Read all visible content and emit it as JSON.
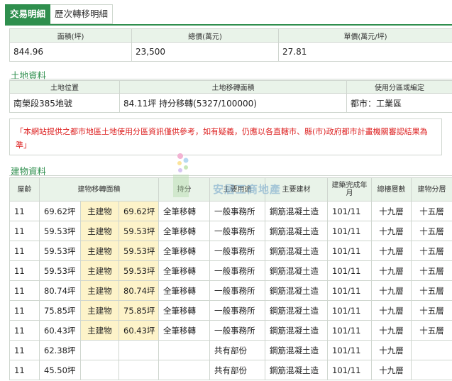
{
  "tabs": [
    {
      "label": "交易明細",
      "active": true
    },
    {
      "label": "歷次轉移明細",
      "active": false
    }
  ],
  "price": {
    "headers": [
      "面積(坪)",
      "總價(萬元)",
      "單價(萬元/坪)"
    ],
    "values": [
      "844.96",
      "23,500",
      "27.81"
    ]
  },
  "land": {
    "title": "土地資料",
    "headers": [
      "土地位置",
      "土地移轉面積",
      "使用分區或編定"
    ],
    "values": [
      "南榮段385地號",
      "84.11坪 持分移轉(5327/100000)",
      "都市：工業區"
    ]
  },
  "notice": "「本網站提供之都市地區土地使用分區資訊僅供參考，如有疑義，仍應以各直轄市、縣(市)政府都市計畫機關審認結果為準」",
  "building": {
    "title": "建物資料",
    "headers": {
      "age": "屋齡",
      "area": "建物移轉面積",
      "share": "持分",
      "use": "主要用途",
      "material": "主要建材",
      "built": "建築完成年月",
      "total_floors": "總樓層數",
      "floor": "建物分層"
    },
    "rows": [
      {
        "age": "11",
        "area": "69.62坪",
        "sub_label": "主建物",
        "sub_area": "69.62坪",
        "share": "全筆移轉",
        "use": "一般事務所",
        "material": "鋼筋混凝土造",
        "built": "101/11",
        "total_floors": "十九層",
        "floor": "十五層"
      },
      {
        "age": "11",
        "area": "59.53坪",
        "sub_label": "主建物",
        "sub_area": "59.53坪",
        "share": "全筆移轉",
        "use": "一般事務所",
        "material": "鋼筋混凝土造",
        "built": "101/11",
        "total_floors": "十九層",
        "floor": "十五層"
      },
      {
        "age": "11",
        "area": "59.53坪",
        "sub_label": "主建物",
        "sub_area": "59.53坪",
        "share": "全筆移轉",
        "use": "一般事務所",
        "material": "鋼筋混凝土造",
        "built": "101/11",
        "total_floors": "十九層",
        "floor": "十五層"
      },
      {
        "age": "11",
        "area": "59.53坪",
        "sub_label": "主建物",
        "sub_area": "59.53坪",
        "share": "全筆移轉",
        "use": "一般事務所",
        "material": "鋼筋混凝土造",
        "built": "101/11",
        "total_floors": "十九層",
        "floor": "十五層"
      },
      {
        "age": "11",
        "area": "80.74坪",
        "sub_label": "主建物",
        "sub_area": "80.74坪",
        "share": "全筆移轉",
        "use": "一般事務所",
        "material": "鋼筋混凝土造",
        "built": "101/11",
        "total_floors": "十九層",
        "floor": "十五層"
      },
      {
        "age": "11",
        "area": "75.85坪",
        "sub_label": "主建物",
        "sub_area": "75.85坪",
        "share": "全筆移轉",
        "use": "一般事務所",
        "material": "鋼筋混凝土造",
        "built": "101/11",
        "total_floors": "十九層",
        "floor": "十五層"
      },
      {
        "age": "11",
        "area": "60.43坪",
        "sub_label": "主建物",
        "sub_area": "60.43坪",
        "share": "全筆移轉",
        "use": "一般事務所",
        "material": "鋼筋混凝土造",
        "built": "101/11",
        "total_floors": "十九層",
        "floor": "十五層"
      },
      {
        "age": "11",
        "area": "62.38坪",
        "sub_label": "",
        "sub_area": "",
        "share": "",
        "use": "共有部份",
        "material": "鋼筋混凝土造",
        "built": "101/11",
        "total_floors": "十九層",
        "floor": ""
      },
      {
        "age": "11",
        "area": "45.50坪",
        "sub_label": "",
        "sub_area": "",
        "share": "",
        "use": "共有部份",
        "material": "鋼筋混凝土造",
        "built": "101/11",
        "total_floors": "十九層",
        "floor": ""
      }
    ]
  },
  "watermark": "安居工商地產",
  "colors": {
    "accent": "#2f8f4e",
    "header_bg": "#e9f3e9",
    "highlight": "#fdf3c9",
    "notice": "#dd2222"
  }
}
